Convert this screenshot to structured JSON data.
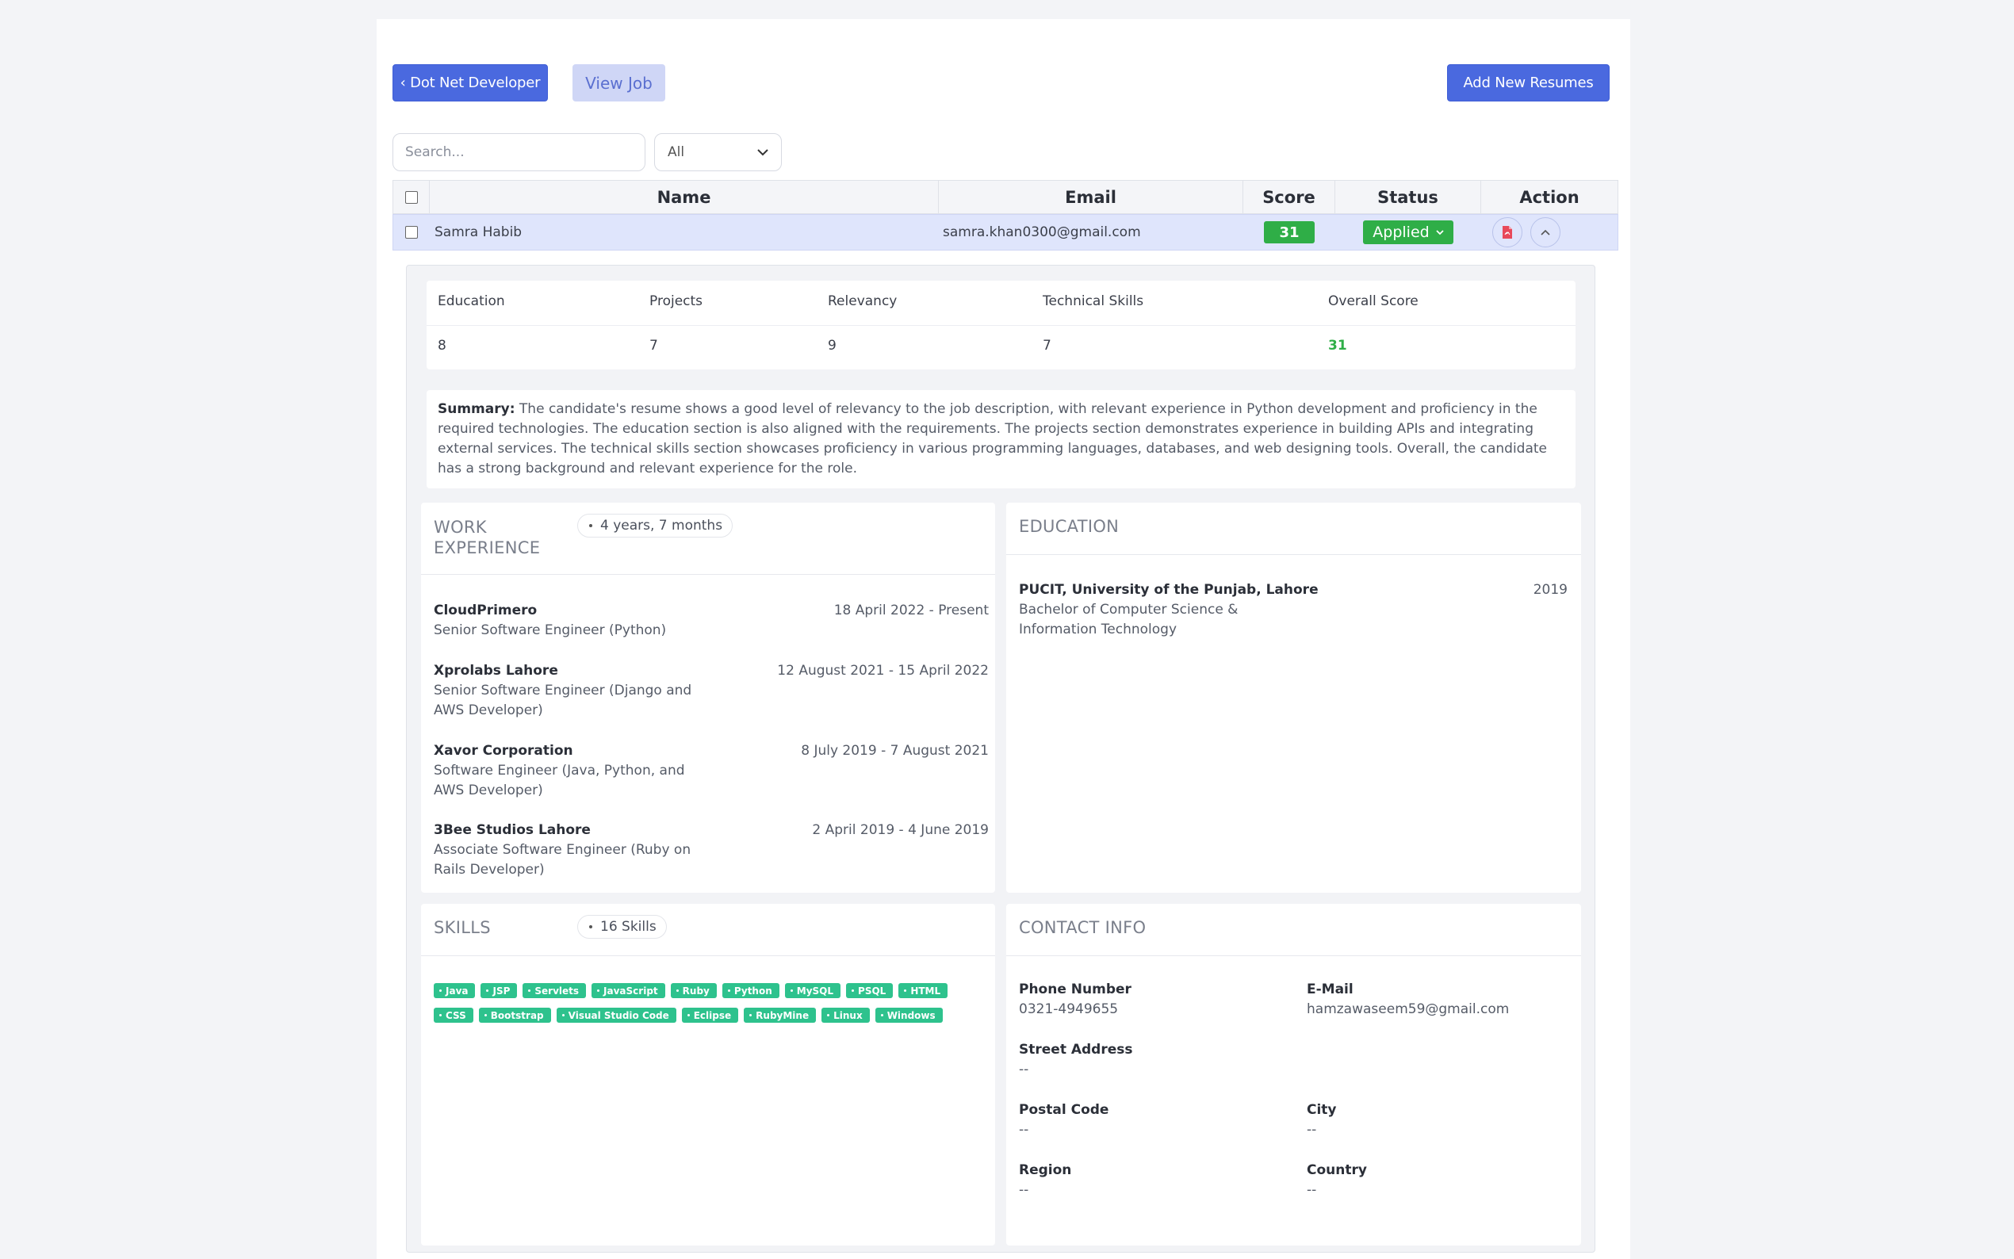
{
  "toolbar": {
    "back_label": "‹ Dot Net Developer",
    "view_job_label": "View Job",
    "add_resumes_label": "Add New Resumes"
  },
  "filters": {
    "search_placeholder": "Search...",
    "status_filter_value": "All"
  },
  "table": {
    "headers": {
      "name": "Name",
      "email": "Email",
      "score": "Score",
      "status": "Status",
      "action": "Action"
    },
    "row": {
      "name": "Samra Habib",
      "email": "samra.khan0300@gmail.com",
      "score": "31",
      "status": "Applied"
    }
  },
  "detail": {
    "scores": {
      "headers": [
        "Education",
        "Projects",
        "Relevancy",
        "Technical Skills",
        "Overall Score"
      ],
      "values": [
        "8",
        "7",
        "9",
        "7",
        "31"
      ]
    },
    "summary_label": "Summary:",
    "summary_text": "The candidate's resume shows a good level of relevancy to the job description, with relevant experience in Python development and proficiency in the required technologies. The education section is also aligned with the requirements. The projects section demonstrates experience in building APIs and integrating external services. The technical skills section showcases proficiency in various programming languages, databases, and web designing tools. Overall, the candidate has a strong background and relevant experience for the role.",
    "work": {
      "title_line1": "WORK",
      "title_line2": "EXPERIENCE",
      "duration": "4 years, 7 months",
      "jobs": [
        {
          "company": "CloudPrimero",
          "role": "Senior Software Engineer (Python)",
          "dates": "18 April 2022 - Present"
        },
        {
          "company": "Xprolabs Lahore",
          "role": "Senior Software Engineer (Django and AWS Developer)",
          "dates": "12 August 2021 - 15 April 2022"
        },
        {
          "company": "Xavor Corporation",
          "role": "Software Engineer (Java, Python, and AWS Developer)",
          "dates": "8 July 2019 - 7 August 2021"
        },
        {
          "company": "3Bee Studios Lahore",
          "role": "Associate Software Engineer (Ruby on Rails Developer)",
          "dates": "2 April 2019 - 4 June 2019"
        }
      ]
    },
    "education": {
      "title": "EDUCATION",
      "items": [
        {
          "institution": "PUCIT, University of the Punjab, Lahore",
          "degree": "Bachelor of Computer Science & Information Technology",
          "year": "2019"
        }
      ]
    },
    "skills": {
      "title": "SKILLS",
      "count_label": "16 Skills",
      "items": [
        "Java",
        "JSP",
        "Servlets",
        "JavaScript",
        "Ruby",
        "Python",
        "MySQL",
        "PSQL",
        "HTML",
        "CSS",
        "Bootstrap",
        "Visual Studio Code",
        "Eclipse",
        "RubyMine",
        "Linux",
        "Windows"
      ]
    },
    "contact": {
      "title": "CONTACT INFO",
      "phone_label": "Phone Number",
      "phone": "0321-4949655",
      "email_label": "E-Mail",
      "email": "hamzawaseem59@gmail.com",
      "street_label": "Street Address",
      "street": "--",
      "postal_label": "Postal Code",
      "postal": "--",
      "city_label": "City",
      "city": "--",
      "region_label": "Region",
      "region": "--",
      "country_label": "Country",
      "country": "--"
    }
  },
  "colors": {
    "primary": "#4a69df",
    "success": "#2fae47",
    "skill_tag": "#2ec28d",
    "row_highlight": "#dfe5fc"
  }
}
